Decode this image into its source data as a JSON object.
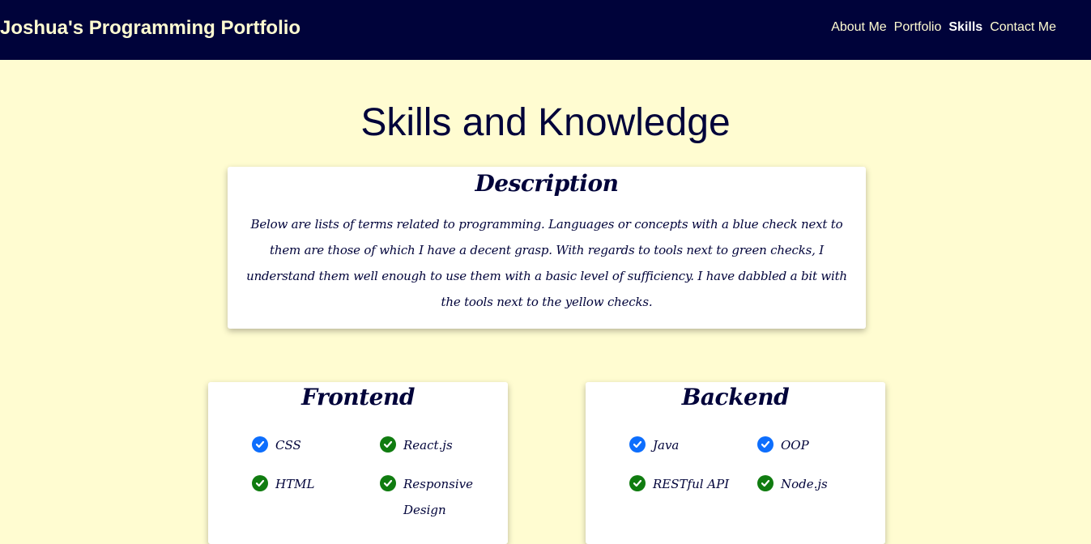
{
  "navbar": {
    "brand": "Joshua's Programming Portfolio",
    "links": [
      "About Me",
      "Portfolio",
      "Skills",
      "Contact Me"
    ],
    "active": "Skills"
  },
  "main": {
    "title": "Skills and Knowledge",
    "description": {
      "title": "Description",
      "text": "Below are lists of terms related to programming. Languages or concepts with a blue check next to them are those of which I have a decent grasp. With regards to tools next to green checks, I understand them well enough to use them with a basic level of sufficiency. I have dabbled a bit with the tools next to the yellow checks."
    },
    "frontend": {
      "title": "Frontend",
      "skills": [
        {
          "label": "CSS",
          "check": "blue"
        },
        {
          "label": "React.js",
          "check": "green"
        },
        {
          "label": "HTML",
          "check": "green"
        },
        {
          "label": "Responsive Design",
          "check": "green"
        }
      ]
    },
    "backend": {
      "title": "Backend",
      "skills": [
        {
          "label": "Java",
          "check": "blue"
        },
        {
          "label": "OOP",
          "check": "blue"
        },
        {
          "label": "RESTful API",
          "check": "green"
        },
        {
          "label": "Node.js",
          "check": "green"
        }
      ]
    }
  },
  "colors": {
    "navy": "#00033a",
    "cream": "#fffcd1",
    "check_blue": "#0d6efd",
    "check_green": "#107c10"
  },
  "icons": {
    "check": "check-circle-icon"
  }
}
